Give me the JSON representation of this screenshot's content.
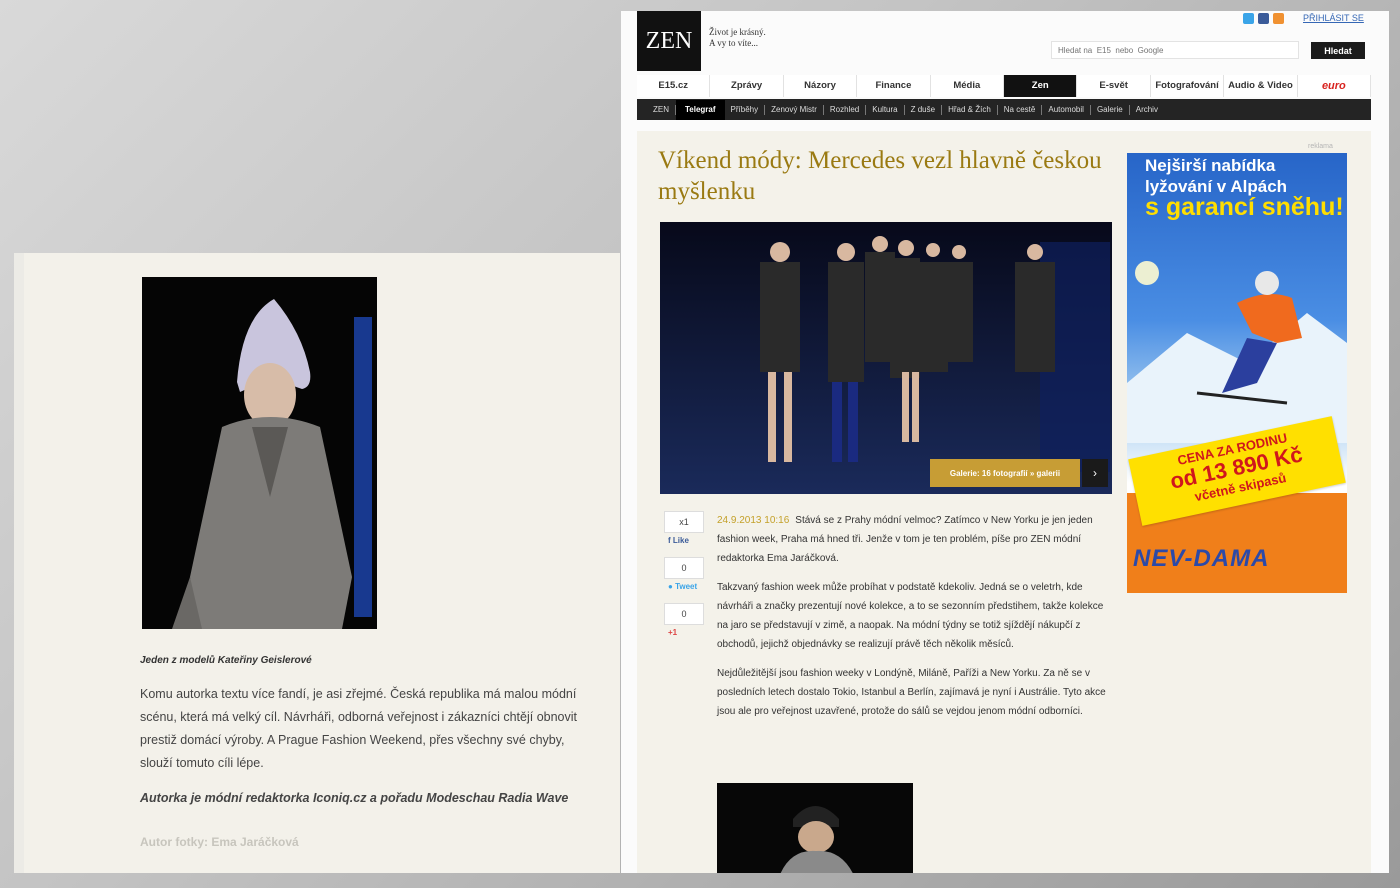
{
  "left_panel": {
    "caption": "Jeden z modelů Kateřiny Geislerové",
    "paragraph": "Komu autorka textu více fandí, je asi zřejmé. Česká republika má malou módní scénu, která má velký cíl. Návrháři, odborná veřejnost i zákazníci chtějí obnovit prestiž domácí výroby. A Prague Fashion Weekend, přes všechny své chyby, slouží tomuto cíli lépe.",
    "author_note": "Autorka je módní redaktorka Iconiq.cz a pořadu Modeschau Radia Wave",
    "photo_credit": "Autor fotky: Ema Jaráčková"
  },
  "site": {
    "logo": "ZEN",
    "tagline_line1": "Život je krásný.",
    "tagline_line2": "A vy to víte...",
    "login_label": "PŘIHLÁSIT SE",
    "search_placeholder": "Hledat na  E15  nebo  Google",
    "search_button": "Hledat",
    "nav": [
      "E15.cz",
      "Zprávy",
      "Názory",
      "Finance",
      "Média",
      "Zen",
      "E-svět",
      "Fotografování",
      "Audio & Video",
      "euro"
    ],
    "subnav": [
      "ZEN",
      "Telegraf",
      "Příběhy",
      "Zenový Mistr",
      "Rozhled",
      "Kultura",
      "Z duše",
      "Hřad & Žích",
      "Na cestě",
      "Automobil",
      "Galerie",
      "Archiv"
    ]
  },
  "article": {
    "title": "Víkend módy: Mercedes vezl hlavně českou myšlenku",
    "gallery_button": "Galerie: 16 fotografií » galerii",
    "gallery_next": "›",
    "date": "24.9.2013 10:16",
    "intro": "Stává se z Prahy módní velmoc? Zatímco v New Yorku je jen jeden fashion week, Praha má hned tři. Jenže v tom je ten problém, píše pro ZEN módní redaktorka Ema Jaráčková.",
    "paragraph1": "Takzvaný fashion week může probíhat v podstatě kdekoliv. Jedná se o veletrh, kde návrháři a značky prezentují nové kolekce, a to se sezonním předstihem, takže kolekce na jaro se představují v zimě, a naopak. Na módní týdny se totiž sjíždějí nákupčí z obchodů, jejichž objednávky se realizují právě těch několik měsíců.",
    "paragraph2": "Nejdůležitější jsou fashion weeky v Londýně, Miláně, Paříži a New Yorku. Za ně se v posledních letech dostalo Tokio, Istanbul a Berlín, zajímavá je nyní i Austrálie. Tyto akce jsou ale pro veřejnost uzavřené, protože do sálů se vejdou jenom módní odborníci."
  },
  "share": {
    "fb_count": "x1",
    "fb_label": "Like",
    "tw_count": "0",
    "tw_label": "Tweet",
    "g_count": "0",
    "g_label": "+1"
  },
  "ad": {
    "mark": "reklama",
    "line1": "Nejširší nabídka lyžování v Alpách",
    "line2": "s garancí sněhu!",
    "price_line1": "CENA ZA RODINU",
    "price_line2": "od 13 890 Kč",
    "price_line3": "včetně skipasů",
    "brand": "NEV-DAMA"
  },
  "colors": {
    "title_gold": "#9a7a12",
    "nav_active": "#111111",
    "subnav_bg": "#242424",
    "euro_red": "#d8231f",
    "ad_blue": "#2765c8",
    "ad_orange": "#f07f1a",
    "ad_yellow": "#ffe000"
  }
}
